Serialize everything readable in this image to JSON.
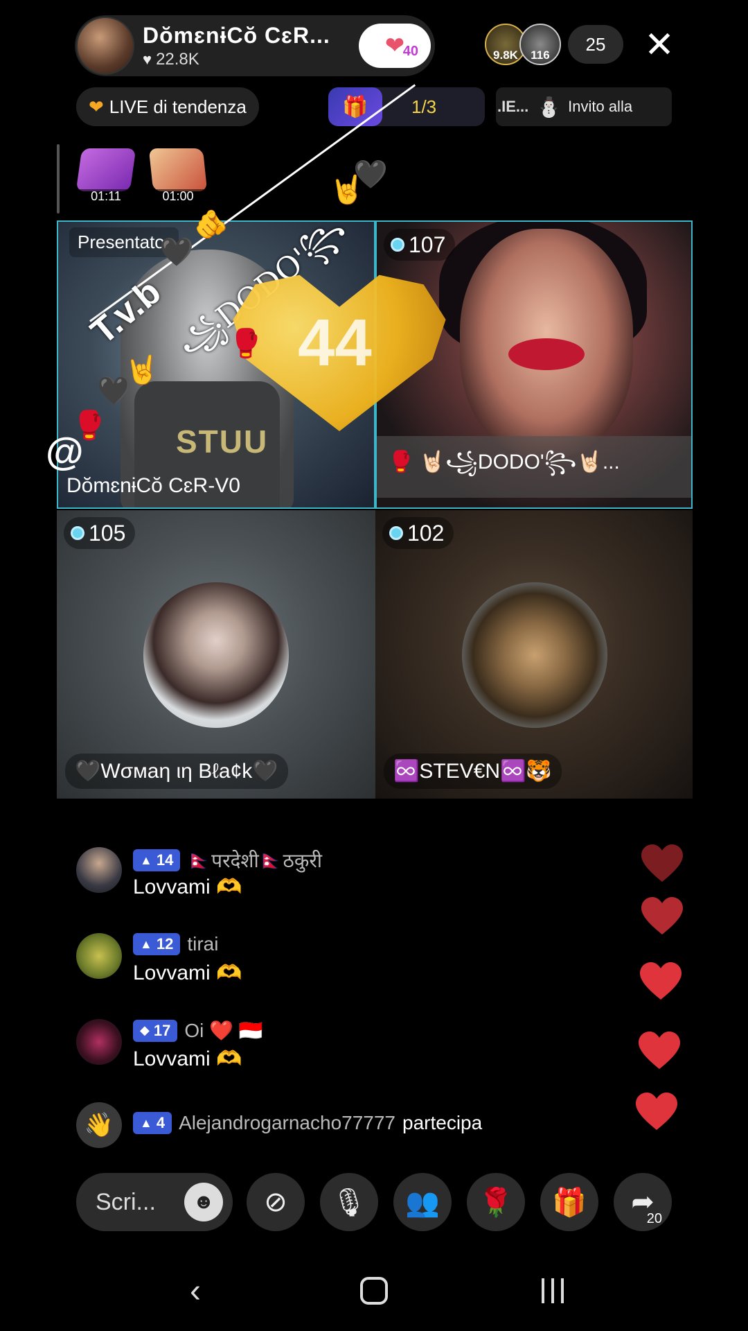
{
  "host": {
    "name": "DŏmɛnɨCŏ CɛR...",
    "likes": "22.8K",
    "follow_badge": "40"
  },
  "viewers": {
    "avatar1_label": "9.8K",
    "avatar2_label": "116",
    "count": "25"
  },
  "tags": {
    "trending": "LIVE di tendenza",
    "rank": "1/3",
    "invite_prefix": ".IE...",
    "invite_text": "Invito alla"
  },
  "gifts": [
    {
      "time": "01:11"
    },
    {
      "time": "01:00"
    }
  ],
  "overlay": {
    "tvb": "T.v.b",
    "dodo": "꧁DODO'꧂",
    "at": "@",
    "number": "44"
  },
  "tiles": [
    {
      "label": "Presentator",
      "name": "DŏmɛnɨCŏ CɛR-V0",
      "shirt": "STUU"
    },
    {
      "level": "107",
      "name": "🥊 🤘🏻꧁DODO'꧂🤘🏻..."
    },
    {
      "level": "105",
      "name": "🖤Wσмaη ιη Bℓa¢k🖤"
    },
    {
      "level": "102",
      "name": "♾️STEV€N♾️🐯"
    }
  ],
  "comments": [
    {
      "level": "14",
      "user": "🇳🇵परदेशी🇳🇵ठकुरी",
      "text": "Lovvami",
      "emoji": "🫶"
    },
    {
      "level": "12",
      "user": "tirai",
      "text": "Lovvami",
      "emoji": "🫶"
    },
    {
      "level": "17",
      "user": "Oi ❤️ 🇮🇩",
      "text": "Lovvami",
      "emoji": "🫶"
    },
    {
      "level": "4",
      "user": "Alejandrogarnacho77777",
      "text": "partecipa"
    }
  ],
  "bottom": {
    "input_placeholder": "Scri...",
    "share_count": "20"
  },
  "colors": {
    "tile_border": "#3cb6c8",
    "level_badge": "#3b5bd6",
    "heart": "#e0343c"
  }
}
